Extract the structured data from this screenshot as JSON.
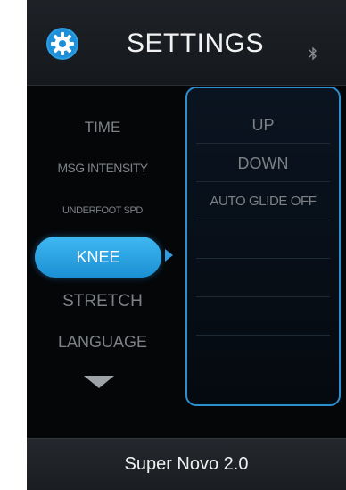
{
  "header": {
    "title": "SETTINGS",
    "settings_icon": "gear-icon",
    "status_icon": "bluetooth-icon"
  },
  "menu": {
    "items": [
      {
        "label": "TIME"
      },
      {
        "label": "MSG INTENSITY"
      },
      {
        "label": "UNDERFOOT SPD"
      },
      {
        "label": "KNEE",
        "selected": true
      },
      {
        "label": "STRETCH"
      },
      {
        "label": "LANGUAGE"
      }
    ],
    "scroll_down_icon": "triangle-down-icon",
    "selection_pointer_icon": "triangle-right-icon"
  },
  "options": {
    "items": [
      {
        "label": "UP"
      },
      {
        "label": "DOWN"
      },
      {
        "label": "AUTO GLIDE OFF"
      },
      {
        "label": ""
      },
      {
        "label": ""
      },
      {
        "label": ""
      },
      {
        "label": ""
      }
    ]
  },
  "footer": {
    "model_name": "Super Novo 2.0"
  },
  "colors": {
    "accent": "#2d8ed0",
    "selected_button": "#2fa6e6",
    "background": "#050608",
    "inactive_text": "#7d8186"
  }
}
